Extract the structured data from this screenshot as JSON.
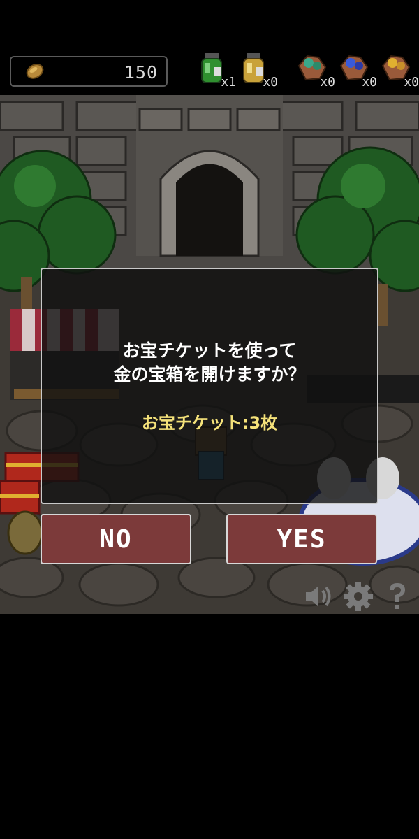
{
  "hud": {
    "coins": "150",
    "items": [
      {
        "name": "green-potion-icon",
        "count": "x1"
      },
      {
        "name": "yellow-potion-icon",
        "count": "x0"
      },
      {
        "name": "green-ore-icon",
        "count": "x0"
      },
      {
        "name": "blue-ore-icon",
        "count": "x0"
      },
      {
        "name": "gold-ore-icon",
        "count": "x0"
      }
    ]
  },
  "dialog": {
    "line1": "お宝チケットを使って",
    "line2": "金の宝箱を開けますか？",
    "ticket": "お宝チケット:3枚",
    "no_label": "NO",
    "yes_label": "YES"
  },
  "controls": [
    "sound-icon",
    "settings-gear-icon",
    "help-icon"
  ],
  "colors": {
    "button_bg": "#7c3a3a",
    "ticket_text": "#f5e27a",
    "dialog_border": "#c9c9c9"
  }
}
